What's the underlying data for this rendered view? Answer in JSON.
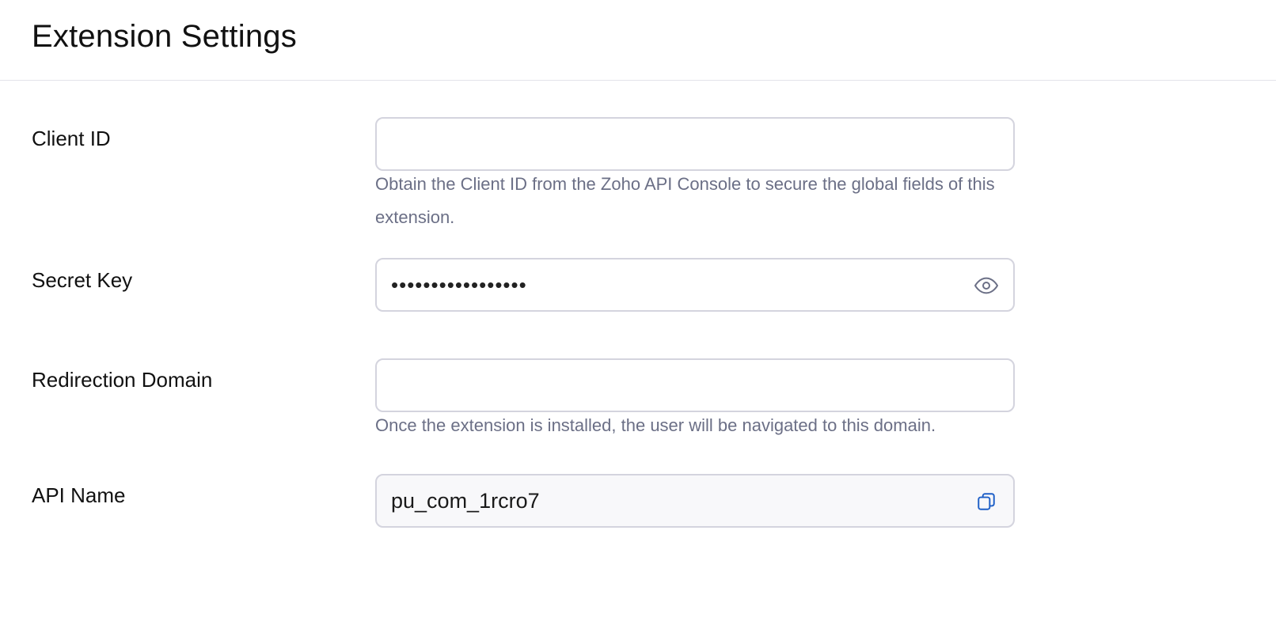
{
  "header": {
    "title": "Extension Settings"
  },
  "form": {
    "client_id": {
      "label": "Client ID",
      "value": "",
      "hint": "Obtain the Client ID from the Zoho API Console to secure the global fields of this extension."
    },
    "secret_key": {
      "label": "Secret Key",
      "masked_value": "•••••••••••••••••",
      "toggle_icon": "eye-icon"
    },
    "redirection_domain": {
      "label": "Redirection Domain",
      "value": "",
      "hint": "Once the extension is installed, the user will be navigated to this domain."
    },
    "api_name": {
      "label": "API Name",
      "value": "pu_com_1rcro7",
      "copy_icon": "copy-icon"
    }
  },
  "colors": {
    "border": "#d4d4de",
    "hint_text": "#6b6f86",
    "accent": "#1e5fc7",
    "readonly_bg": "#f8f8fa"
  }
}
